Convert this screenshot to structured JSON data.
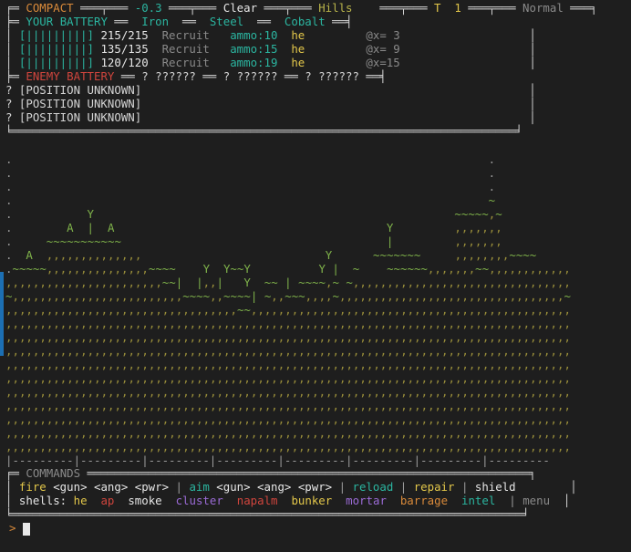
{
  "header": {
    "l1_pre": "╒═ ",
    "mode": "COMPACT",
    "sep1": " ═══╤═══ ",
    "wind": "-0.3",
    "sep2": " ═══╤═══ ",
    "weather": "Clear",
    "sep3": " ═══╤═══ ",
    "terrain_type": "Hills",
    "sep4": "    ═══╤═══ ",
    "turn_label": "T",
    "turn_value": "1",
    "sep5": " ═══╤═══ ",
    "difficulty": "Normal",
    "end": " ═══╕"
  },
  "battery": {
    "title_pre": "╞═ ",
    "title": "YOUR BATTERY",
    "title_mid": " ══  ",
    "gun1": "Iron",
    "sep_a": "  ══  ",
    "gun2": "Steel",
    "sep_b": "  ══  ",
    "gun3": "Cobalt",
    "title_end": " ══╡",
    "rows": [
      {
        "bar": "[|||||||||]",
        "hp": "215/215",
        "rank": "Recruit",
        "ammo": "ammo:10",
        "shell": "he",
        "pos": "@x= 3"
      },
      {
        "bar": "[|||||||||]",
        "hp": "135/135",
        "rank": "Recruit",
        "ammo": "ammo:15",
        "shell": "he",
        "pos": "@x= 9"
      },
      {
        "bar": "[|||||||||]",
        "hp": "120/120",
        "rank": "Recruit",
        "ammo": "ammo:19",
        "shell": "he",
        "pos": "@x=15"
      }
    ]
  },
  "enemy": {
    "title_pre": "╞═ ",
    "title": "ENEMY BATTERY",
    "rest": " ══ ? ?????? ══ ? ?????? ══ ? ?????? ══╡",
    "rows": [
      "? [POSITION UNKNOWN]",
      "? [POSITION UNKNOWN]",
      "? [POSITION UNKNOWN]"
    ],
    "box_bottom": "╘══════════════════════════════════════════════════════════════════════════╛"
  },
  "battlefield": [
    ".                                                                      .",
    ".                                                                      .",
    ".                                                                      .",
    ".                                                                      ~",
    ".           Y                                                     ~~~~~,~",
    ".        A  |  A                                        Y         ,,,,,,,",
    ".     ~~~~~~~~~~~                                       |         ,,,,,,,",
    ".  A  ,,,,,,,,,,,,,,                           Y      ~~~~~~~     ,,,,,,,,~~~~",
    ".~~~~~,,,,,,,,,,,,,,,~~~~    Y  Y~~Y          Y |  ~    ~~~~~~,,,,,,,~~,,,,,,,,,,,,",
    ",,,,,,,,,,,,,,,,,,,,,,,~~|  |,,|   Y  ~~ | ~~~~,~ ~,,,,,,,,,,,,,,,,,,,,,,,,,,,,,,,,",
    "~,,,,,,,,,,,,,,,,,,,,,,,,,~~~~,,~~~~| ~,,~~~,,,,~,,,,,,,,,,,,,,,,,,,,,,,,,,,,,,,,,~",
    ",,,,,,,,,,,,,,,,,,,,,,,,,,,,,,,,,,~~,,,,,,,,,,,,,,,,,,,,,,,,,,,,,,,,,,,,,,,,,,,,,,,",
    ",,,,,,,,,,,,,,,,,,,,,,,,,,,,,,,,,,,,,,,,,,,,,,,,,,,,,,,,,,,,,,,,,,,,,,,,,,,,,,,,,,,",
    ",,,,,,,,,,,,,,,,,,,,,,,,,,,,,,,,,,,,,,,,,,,,,,,,,,,,,,,,,,,,,,,,,,,,,,,,,,,,,,,,,,,",
    ",,,,,,,,,,,,,,,,,,,,,,,,,,,,,,,,,,,,,,,,,,,,,,,,,,,,,,,,,,,,,,,,,,,,,,,,,,,,,,,,,,,",
    ",,,,,,,,,,,,,,,,,,,,,,,,,,,,,,,,,,,,,,,,,,,,,,,,,,,,,,,,,,,,,,,,,,,,,,,,,,,,,,,,,,,",
    ",,,,,,,,,,,,,,,,,,,,,,,,,,,,,,,,,,,,,,,,,,,,,,,,,,,,,,,,,,,,,,,,,,,,,,,,,,,,,,,,,,,",
    ",,,,,,,,,,,,,,,,,,,,,,,,,,,,,,,,,,,,,,,,,,,,,,,,,,,,,,,,,,,,,,,,,,,,,,,,,,,,,,,,,,,",
    ",,,,,,,,,,,,,,,,,,,,,,,,,,,,,,,,,,,,,,,,,,,,,,,,,,,,,,,,,,,,,,,,,,,,,,,,,,,,,,,,,,,",
    ",,,,,,,,,,,,,,,,,,,,,,,,,,,,,,,,,,,,,,,,,,,,,,,,,,,,,,,,,,,,,,,,,,,,,,,,,,,,,,,,,,,",
    ",,,,,,,,,,,,,,,,,,,,,,,,,,,,,,,,,,,,,,,,,,,,,,,,,,,,,,,,,,,,,,,,,,,,,,,,,,,,,,,,,,,",
    ",,,,,,,,,,,,,,,,,,,,,,,,,,,,,,,,,,,,,,,,,,,,,,,,,,,,,,,,,,,,,,,,,,,,,,,,,,,,,,,,,,,"
  ],
  "ruler": "|---------|---------|---------|---------|---------|---------|---------|---------",
  "commands": {
    "title_pre": "╒═ ",
    "title": "COMMANDS",
    "fire": "fire",
    "fire_args": " <gun> <ang> <pwr>",
    "aim": "aim",
    "aim_args": " <gun> <ang> <pwr>",
    "reload": "reload",
    "repair": "repair",
    "shield": "shield",
    "shells_label": "shells:",
    "shells": [
      {
        "name": "he",
        "color": "#e3c74a"
      },
      {
        "name": "ap",
        "color": "#d0453d"
      },
      {
        "name": "smoke",
        "color": "#e6e6e6"
      },
      {
        "name": "cluster",
        "color": "#9b6bd6"
      },
      {
        "name": "napalm",
        "color": "#d0453d"
      },
      {
        "name": "bunker",
        "color": "#e3c74a"
      },
      {
        "name": "mortar",
        "color": "#9b6bd6"
      },
      {
        "name": "barrage",
        "color": "#d98a3a"
      },
      {
        "name": "intel",
        "color": "#2bb5a0"
      }
    ],
    "menu": "menu"
  },
  "prompt": ">"
}
